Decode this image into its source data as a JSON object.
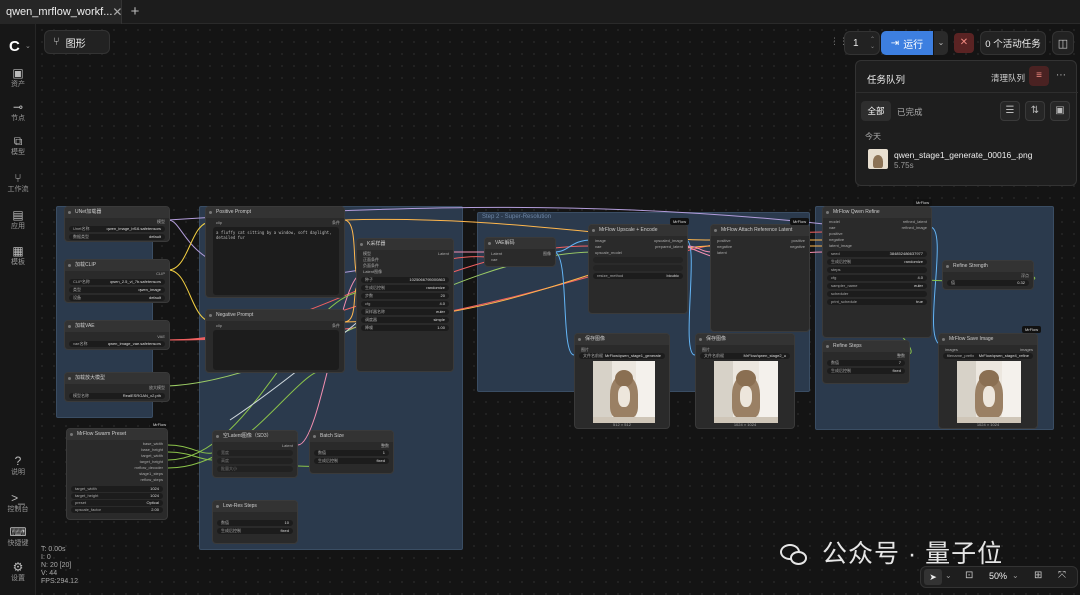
{
  "tab": {
    "title": "qwen_mrflow_workf...",
    "close": "✕",
    "new": "+"
  },
  "sidebar": {
    "logo": "C",
    "items": [
      {
        "icon": "image-icon",
        "glyph": "▣",
        "label": "资产"
      },
      {
        "icon": "node-icon",
        "glyph": "⊸",
        "label": "节点"
      },
      {
        "icon": "models-icon",
        "glyph": "⧉",
        "label": "模型"
      },
      {
        "icon": "workflow-icon",
        "glyph": "⑂",
        "label": "工作流"
      },
      {
        "icon": "apps-icon",
        "glyph": "▤",
        "label": "应用"
      },
      {
        "icon": "templates-icon",
        "glyph": "▦",
        "label": "模板"
      }
    ],
    "bottom": [
      {
        "icon": "help-icon",
        "glyph": "?",
        "label": "说明"
      },
      {
        "icon": "console-icon",
        "glyph": ">_",
        "label": "控制台"
      },
      {
        "icon": "keyboard-icon",
        "glyph": "⌨",
        "label": "快捷键"
      },
      {
        "icon": "settings-icon",
        "glyph": "⚙",
        "label": "设置"
      }
    ]
  },
  "toolbar": {
    "graph_label": "图形",
    "run_count": "1",
    "run_label": "运行",
    "active_tasks": "0 个活动任务"
  },
  "queue": {
    "title": "任务队列",
    "clear_label": "清理队列",
    "filter_all": "全部",
    "filter_done": "已完成",
    "today": "今天",
    "item_name": "qwen_stage1_generate_00016_.png",
    "item_time": "5.75s"
  },
  "stats": {
    "t": "T: 0.00s",
    "i": "I: 0",
    "n": "N: 20 [20]",
    "v": "V: 44",
    "fps": "FPS:294.12"
  },
  "zoom": {
    "level": "50%"
  },
  "watermark": "公众号 · 量子位",
  "canvas": {
    "group1_title": "",
    "group2_title": "Step 2 - Super-Resolution",
    "mrflow_badge": "MrFlow",
    "nodes": {
      "unet": {
        "title": "UNet加载器",
        "f1k": "Unet名称",
        "f1v": "qwen_image_bf16.safetensors",
        "f2k": "数据类型",
        "f2v": "default",
        "out": "模型"
      },
      "clip": {
        "title": "加载CLIP",
        "f1k": "CLIP名称",
        "f1v": "qwen_2.5_vl_7b.safetensors",
        "f2k": "类型",
        "f2v": "qwen_image",
        "f3k": "设备",
        "f3v": "default",
        "out": "CLIP"
      },
      "vae": {
        "title": "加载VAE",
        "f1k": "vae名称",
        "f1v": "qwen_image_vae.safetensors",
        "out": "VAE"
      },
      "upscale_model": {
        "title": "加载放大模型",
        "f1k": "模型名称",
        "f1v": "RealESRGAN_x2.pth",
        "out": "放大模型"
      },
      "pos": {
        "title": "Positive Prompt",
        "in": "clip",
        "out": "条件",
        "text": "a fluffy cat sitting by a window, soft daylight, detailed fur"
      },
      "neg": {
        "title": "Negative Prompt",
        "in": "clip",
        "out": "条件",
        "text": ""
      },
      "ksampler": {
        "title": "K采样器",
        "ins": [
          "模型",
          "正面条件",
          "负面条件",
          "Latent图像"
        ],
        "out": "Latent",
        "fields": [
          [
            "种子",
            "1025066795000863"
          ],
          [
            "生成后控制",
            "randomize"
          ],
          [
            "步数",
            "20"
          ],
          [
            "cfg",
            "4.0"
          ],
          [
            "采样器名称",
            "euler"
          ],
          [
            "调度器",
            "simple"
          ],
          [
            "降噪",
            "1.00"
          ]
        ]
      },
      "vaedecode": {
        "title": "VAE解码",
        "ins": [
          "Latent",
          "vae"
        ],
        "out": "图像"
      },
      "upscale_encode": {
        "title": "MrFlow Upscale + Encode",
        "ins": [
          "image",
          "vae",
          "upscale_model"
        ],
        "outs": [
          "upscaled_image",
          "prepared_latent"
        ],
        "f1k": "resize_method",
        "f1v": "bicubic"
      },
      "attach_latent": {
        "title": "MrFlow Attach Reference Latent",
        "ins": [
          "positive",
          "negative",
          "latent"
        ],
        "outs": [
          "positive",
          "negative"
        ]
      },
      "refine": {
        "title": "MrFlow Qwen Refine",
        "ins": [
          "model",
          "vae",
          "positive",
          "negative",
          "latent_image"
        ],
        "outs": [
          "refined_latent",
          "refined_image"
        ],
        "fields": [
          [
            "seed",
            "384852486637977"
          ],
          [
            "生成后控制",
            "randomize"
          ],
          [
            "steps",
            ""
          ],
          [
            "cfg",
            "4.0"
          ],
          [
            "sampler_name",
            "euler"
          ],
          [
            "scheduler",
            ""
          ],
          [
            "print_schedule",
            "true"
          ]
        ]
      },
      "refine_strength": {
        "title": "Refine Strength",
        "out": "浮点",
        "f1k": "值",
        "f1v": "0.32"
      },
      "refine_steps": {
        "title": "Refine Steps",
        "out": "整数",
        "f1k": "数值",
        "f1v": "7",
        "f2k": "生成后控制",
        "f2v": "fixed"
      },
      "save1": {
        "title": "保存图像",
        "in": "图片",
        "f1k": "文件名前缀",
        "f1v": "MrFlow/qwen_stage1_generate",
        "caption": "512 × 512"
      },
      "save2": {
        "title": "保存图像",
        "in": "图片",
        "f1k": "文件名前缀",
        "f1v": "MrFlow/qwen_stage2_u",
        "caption": "1024 × 1024"
      },
      "save3": {
        "title": "MrFlow Save Image",
        "in": "images",
        "out": "images",
        "f1k": "filename_prefix",
        "f1v": "MrFlow/qwen_stage4_refine",
        "caption": "1024 × 1024"
      },
      "swarm": {
        "title": "MrFlow Swarm Preset",
        "outs": [
          "base_width",
          "base_height",
          "target_width",
          "target_height",
          "mrflow_decoder",
          "stage1_steps",
          "reflow_steps"
        ],
        "fields": [
          [
            "target_width",
            "1024"
          ],
          [
            "target_height",
            "1024"
          ],
          [
            "preset",
            "Optical"
          ],
          [
            "upscale_factor",
            "2.00"
          ]
        ]
      },
      "empty_latent": {
        "title": "空Latent图像（SD3）",
        "out": "Latent",
        "f1k": "宽度",
        "f2k": "高度",
        "f3k": "批量大小"
      },
      "batch": {
        "title": "Batch Size",
        "out": "整数",
        "f1k": "数值",
        "f1v": "1",
        "f2k": "生成后控制",
        "f2v": "fixed"
      },
      "lowres": {
        "title": "Low-Res Steps",
        "f1k": "数值",
        "f1v": "10",
        "f2k": "生成后控制",
        "f2v": "fixed"
      }
    }
  }
}
